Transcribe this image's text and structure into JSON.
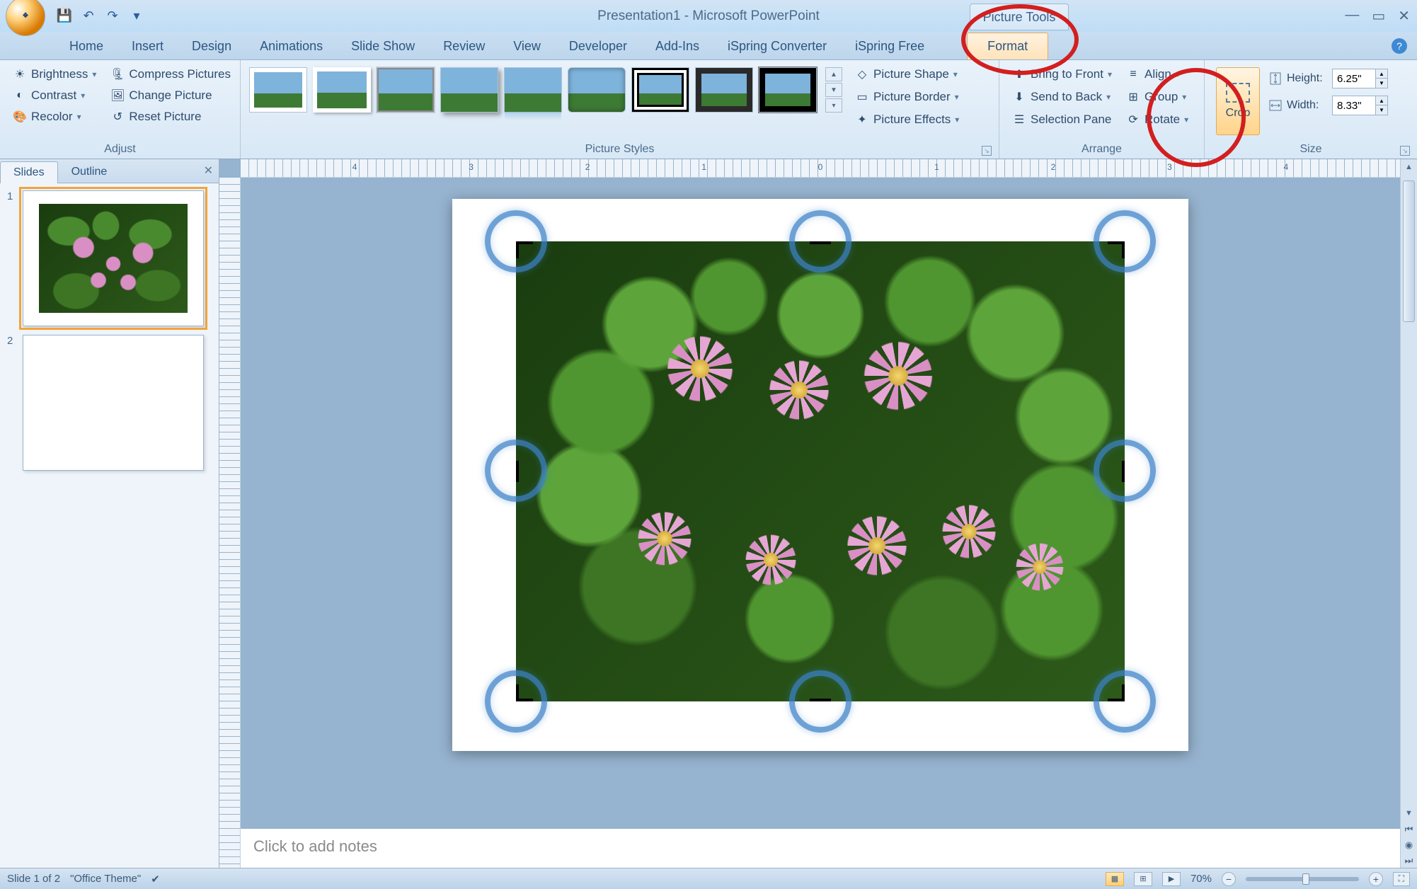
{
  "app": {
    "title": "Presentation1 - Microsoft PowerPoint",
    "contextual_tab": "Picture Tools"
  },
  "qat": {
    "save": "💾",
    "undo": "↶",
    "redo": "↷"
  },
  "tabs": [
    "Home",
    "Insert",
    "Design",
    "Animations",
    "Slide Show",
    "Review",
    "View",
    "Developer",
    "Add-Ins",
    "iSpring Converter",
    "iSpring Free"
  ],
  "active_tab": "Format",
  "ribbon": {
    "adjust": {
      "label": "Adjust",
      "brightness": "Brightness",
      "contrast": "Contrast",
      "recolor": "Recolor",
      "compress": "Compress Pictures",
      "change": "Change Picture",
      "reset": "Reset Picture"
    },
    "styles": {
      "label": "Picture Styles",
      "shape": "Picture Shape",
      "border": "Picture Border",
      "effects": "Picture Effects"
    },
    "arrange": {
      "label": "Arrange",
      "front": "Bring to Front",
      "back": "Send to Back",
      "selpane": "Selection Pane",
      "align": "Align",
      "group": "Group",
      "rotate": "Rotate"
    },
    "size": {
      "label": "Size",
      "crop": "Crop",
      "height_label": "Height:",
      "width_label": "Width:",
      "height_value": "6.25\"",
      "width_value": "8.33\""
    }
  },
  "panel": {
    "slides_tab": "Slides",
    "outline_tab": "Outline",
    "slide_numbers": [
      "1",
      "2"
    ]
  },
  "ruler_numbers": [
    "4",
    "3",
    "2",
    "1",
    "0",
    "1",
    "2",
    "3",
    "4"
  ],
  "notes_placeholder": "Click to add notes",
  "status": {
    "slide": "Slide 1 of 2",
    "theme": "\"Office Theme\"",
    "zoom": "70%"
  }
}
